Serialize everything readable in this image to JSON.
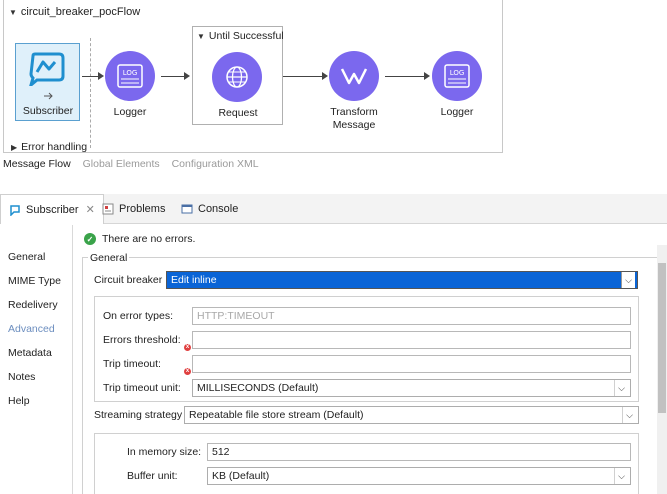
{
  "flow": {
    "name": "circuit_breaker_pocFlow",
    "scope_title": "Until Successful",
    "nodes": [
      {
        "label": "Subscriber"
      },
      {
        "label": "Logger"
      },
      {
        "label": "Request"
      },
      {
        "label": "Transform Message"
      },
      {
        "label": "Logger"
      }
    ],
    "error_handling": "Error handling"
  },
  "editor_tabs": [
    {
      "label": "Message Flow",
      "active": true
    },
    {
      "label": "Global Elements",
      "active": false
    },
    {
      "label": "Configuration XML",
      "active": false
    }
  ],
  "panel_tabs": [
    {
      "label": "Subscriber",
      "active": true,
      "close": "✕"
    },
    {
      "label": "Problems",
      "active": false
    },
    {
      "label": "Console",
      "active": false
    }
  ],
  "sidebar": {
    "items": [
      {
        "label": "General"
      },
      {
        "label": "MIME Type"
      },
      {
        "label": "Redelivery"
      },
      {
        "label": "Advanced",
        "active": true
      },
      {
        "label": "Metadata"
      },
      {
        "label": "Notes"
      },
      {
        "label": "Help"
      }
    ]
  },
  "status": {
    "message": "There are no errors."
  },
  "general": {
    "title": "General",
    "circuit_breaker": {
      "label": "Circuit breaker",
      "value": "Edit inline"
    },
    "on_error_types": {
      "label": "On error types:",
      "placeholder": "HTTP:TIMEOUT",
      "value": ""
    },
    "errors_threshold": {
      "label": "Errors threshold:",
      "value": ""
    },
    "trip_timeout": {
      "label": "Trip timeout:",
      "value": ""
    },
    "trip_timeout_unit": {
      "label": "Trip timeout unit:",
      "value": "MILLISECONDS (Default)"
    },
    "streaming_strategy": {
      "label": "Streaming strategy",
      "value": "Repeatable file store stream (Default)"
    },
    "in_memory_size": {
      "label": "In memory size:",
      "value": "512"
    },
    "buffer_unit": {
      "label": "Buffer unit:",
      "value": "KB (Default)"
    }
  },
  "colors": {
    "accent": "#0a64d6",
    "node_purple": "#7b68ee",
    "success": "#3aa34a",
    "error": "#e04040",
    "active_nav": "#6c8ebf"
  }
}
